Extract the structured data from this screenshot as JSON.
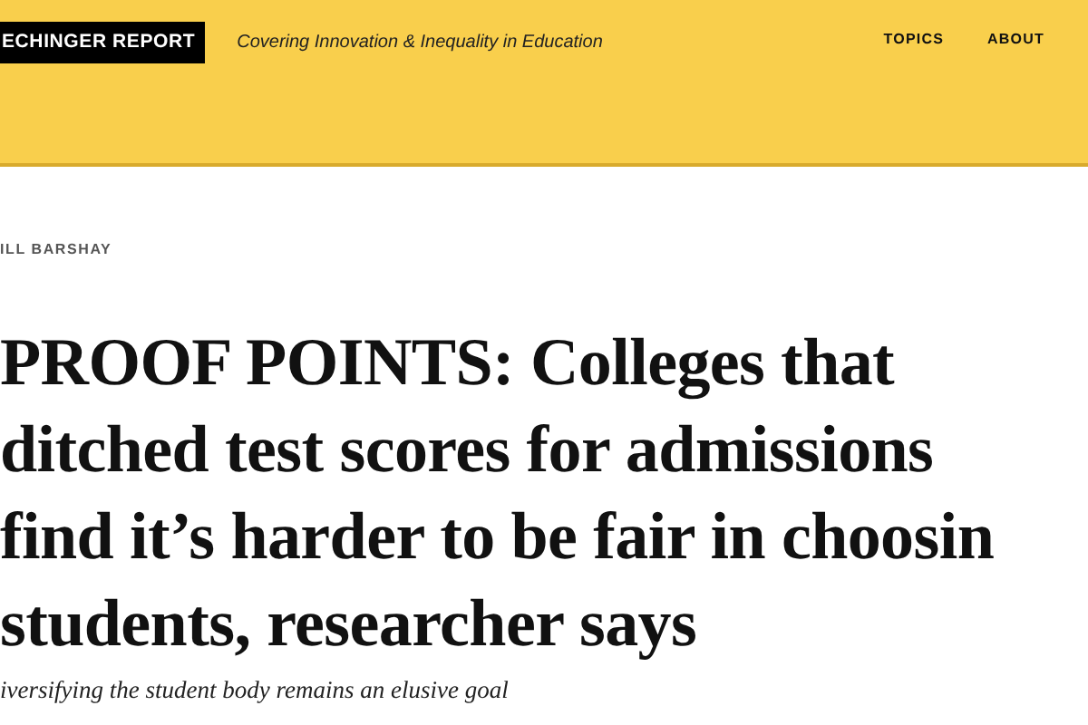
{
  "header": {
    "logo": "ECHINGER REPORT",
    "tagline": "Covering Innovation & Inequality in Education",
    "nav": [
      {
        "label": "TOPICS"
      },
      {
        "label": "ABOUT"
      }
    ]
  },
  "article": {
    "byline": "ILL BARSHAY",
    "headline_lines": [
      "PROOF POINTS: Colleges that",
      "ditched test scores for admissions",
      "find it’s harder to be fair in choosin",
      "students, researcher says"
    ],
    "subtitle": "iversifying the student body remains an elusive goal"
  }
}
